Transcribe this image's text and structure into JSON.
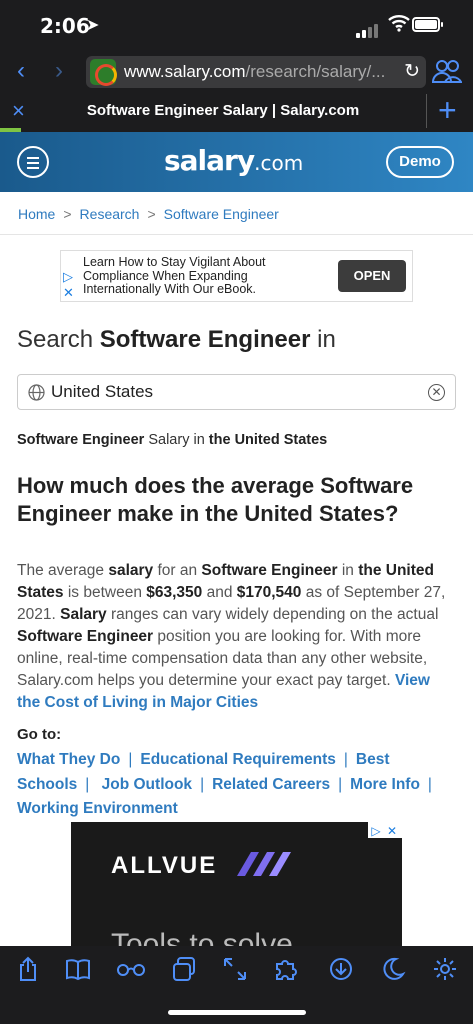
{
  "status_bar": {
    "time": "2:06"
  },
  "browser": {
    "url_host": "www.salary.com",
    "url_path": "/research/salary/...",
    "tab_title": "Software Engineer Salary | Salary.com",
    "load_progress": 0.045
  },
  "site": {
    "logo_main": "salary",
    "logo_suffix": ".com",
    "demo_label": "Demo"
  },
  "breadcrumb": [
    "Home",
    "Research",
    "Software Engineer"
  ],
  "ad": {
    "text": "Learn How to Stay Vigilant About Compliance When Expanding Internationally With Our eBook.",
    "button": "OPEN"
  },
  "search": {
    "prefix": "Search",
    "job": "Software Engineer",
    "suffix": "in",
    "location_value": "United States"
  },
  "subtitle": {
    "job": "Software Engineer",
    "mid": "Salary in",
    "place": "the United States"
  },
  "heading": "How much does the average Software Engineer make in the United States?",
  "paragraph": {
    "t1": "The average ",
    "b1": "salary",
    "t2": " for an ",
    "b2": "Software Engineer",
    "t3": " in ",
    "b3": "the United States",
    "t4": " is between ",
    "b4": "$63,350",
    "t5": " and ",
    "b5": "$170,540",
    "t6": " as of September 27, 2021. ",
    "b6": "Salary",
    "t7": " ranges can vary widely depending on the actual ",
    "b7": "Software Engineer",
    "t8": " position you are looking for. With more online, real-time compensation data than any other website, Salary.com helps you determine your exact pay target. ",
    "link": "View the Cost of Living in Major Cities"
  },
  "goto": {
    "label": "Go to:",
    "links": [
      "What They Do",
      "Educational Requirements",
      "Best Schools",
      "Job Outlook",
      "Related Careers",
      "More Info",
      "Working Environment"
    ]
  },
  "banner": {
    "brand": "ALLVUE",
    "tagline": "Tools to solve"
  },
  "colors": {
    "accent": "#2f7bbf",
    "header_start": "#1a5a8c",
    "header_end": "#2f86c4",
    "progress": "#7fc443"
  }
}
